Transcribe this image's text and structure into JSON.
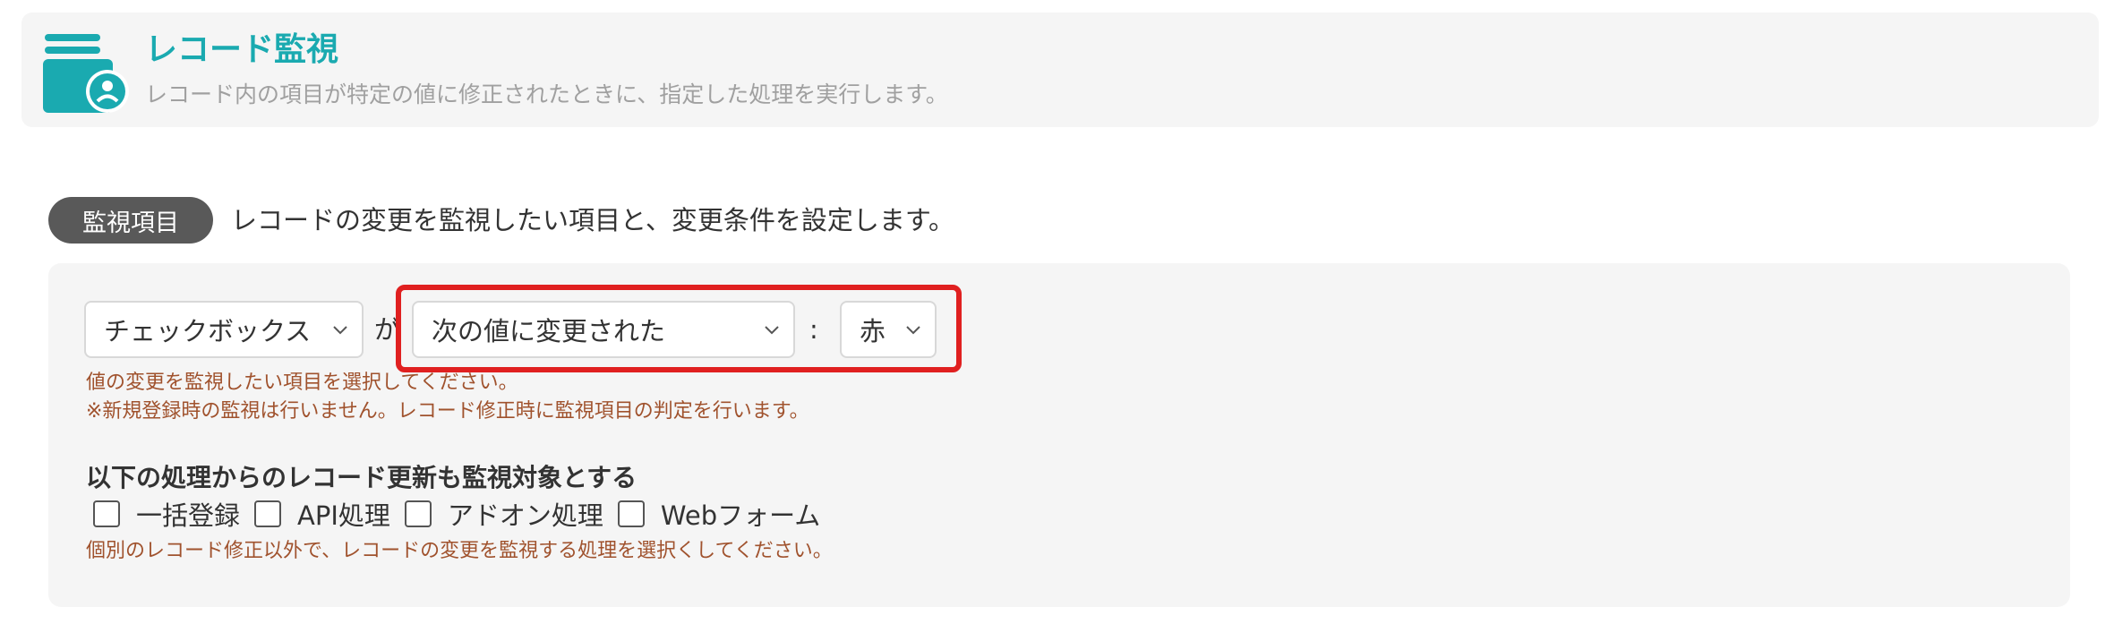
{
  "header": {
    "title": "レコード監視",
    "description": "レコード内の項目が特定の値に修正されたときに、指定した処理を実行します。",
    "icon": "record-watch-icon",
    "accent_color": "#1aaab0"
  },
  "section": {
    "label": "監視項目",
    "description": "レコードの変更を監視したい項目と、変更条件を設定します。"
  },
  "condition": {
    "field_select": "チェックボックス",
    "particle": "が",
    "condition_select": "次の値に変更された",
    "colon": ":",
    "value_select": "赤",
    "highlight_color": "#e02020"
  },
  "help": {
    "line1": "値の変更を監視したい項目を選択してください。",
    "line2": "※新規登録時の監視は行いません。レコード修正時に監視項目の判定を行います。",
    "line3": "個別のレコード修正以外で、レコードの変更を監視する処理を選択くしてください。"
  },
  "targets": {
    "heading": "以下の処理からのレコード更新も監視対象とする",
    "options": [
      {
        "label": "一括登録",
        "checked": false
      },
      {
        "label": "API処理",
        "checked": false
      },
      {
        "label": "アドオン処理",
        "checked": false
      },
      {
        "label": "Webフォーム",
        "checked": false
      }
    ]
  }
}
